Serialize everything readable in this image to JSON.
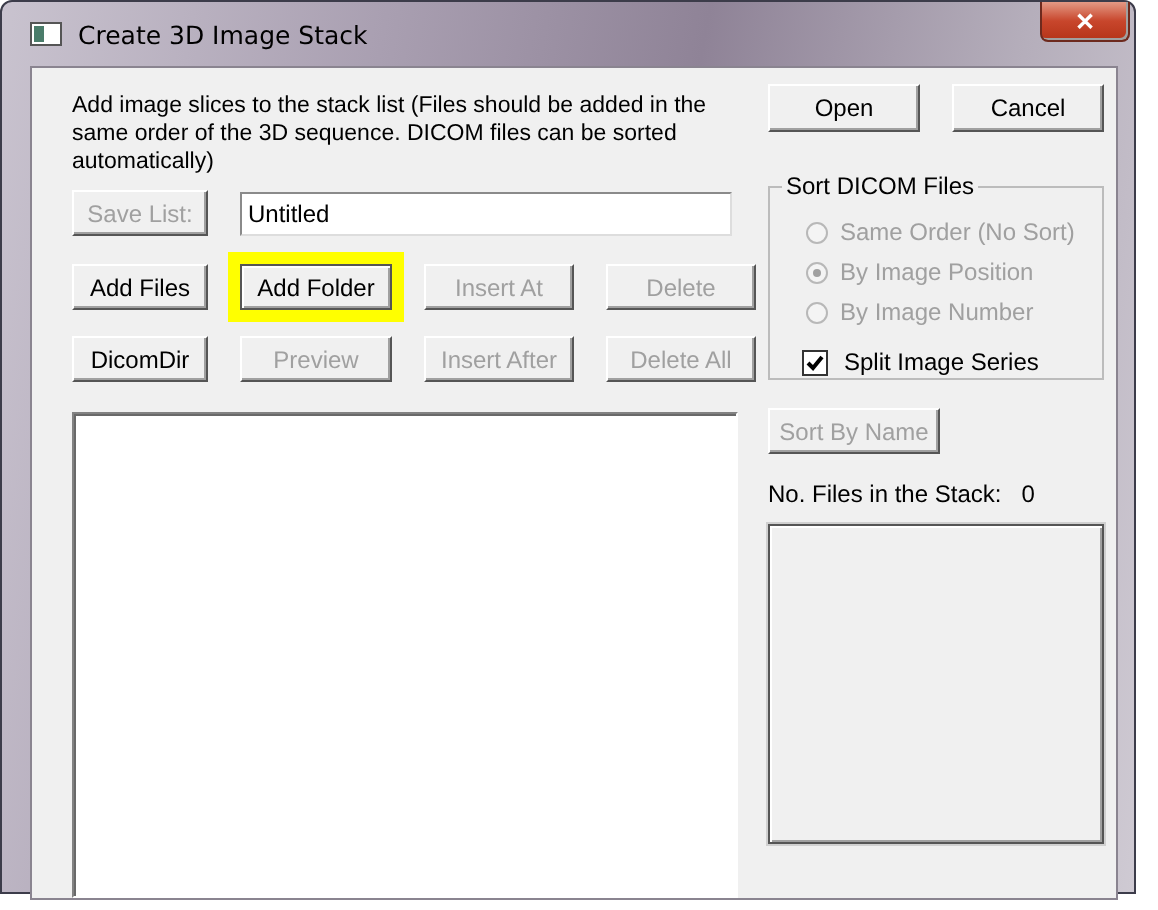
{
  "window": {
    "title": "Create 3D Image Stack",
    "close": "✕"
  },
  "instructions": "Add image slices to the stack list (Files should be added in the same order of the 3D sequence. DICOM files can be sorted automatically)",
  "save_list": {
    "label": "Save List:",
    "disabled": true
  },
  "list_name": {
    "value": "Untitled"
  },
  "button_rows": [
    [
      {
        "label": "Add Files",
        "disabled": false,
        "highlighted": false
      },
      {
        "label": "Add Folder",
        "disabled": false,
        "highlighted": true
      },
      {
        "label": "Insert At",
        "disabled": true,
        "highlighted": false
      },
      {
        "label": "Delete",
        "disabled": true,
        "highlighted": false
      }
    ],
    [
      {
        "label": "DicomDir",
        "disabled": false,
        "highlighted": false
      },
      {
        "label": "Preview",
        "disabled": true,
        "highlighted": false
      },
      {
        "label": "Insert After",
        "disabled": true,
        "highlighted": false
      },
      {
        "label": "Delete All",
        "disabled": true,
        "highlighted": false
      }
    ]
  ],
  "dialog_buttons": [
    {
      "label": "Open",
      "disabled": false
    },
    {
      "label": "Cancel",
      "disabled": false
    }
  ],
  "sort_group": {
    "title": "Sort DICOM Files",
    "options": [
      {
        "label": "Same Order (No Sort)",
        "selected": false,
        "disabled": true
      },
      {
        "label": "By Image Position",
        "selected": true,
        "disabled": true
      },
      {
        "label": "By Image Number",
        "selected": false,
        "disabled": true
      }
    ],
    "split": {
      "label": "Split Image Series",
      "checked": true
    }
  },
  "sort_by_name": {
    "label": "Sort By Name",
    "disabled": true
  },
  "files_count": {
    "label": "No. Files in the Stack:",
    "value": "0"
  }
}
